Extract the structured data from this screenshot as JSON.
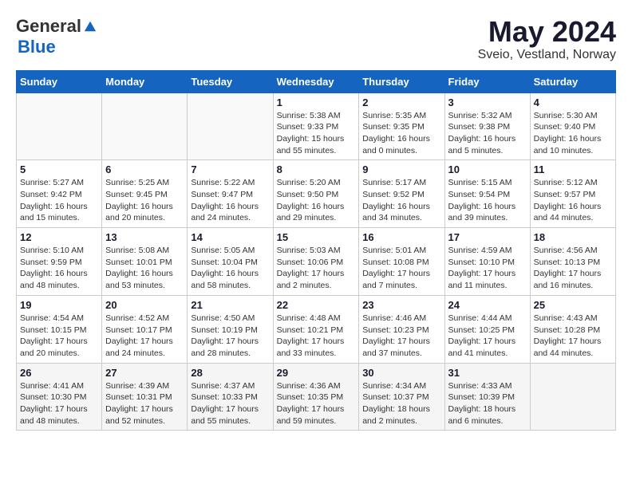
{
  "logo": {
    "general": "General",
    "blue": "Blue"
  },
  "title": {
    "month_year": "May 2024",
    "location": "Sveio, Vestland, Norway"
  },
  "weekdays": [
    "Sunday",
    "Monday",
    "Tuesday",
    "Wednesday",
    "Thursday",
    "Friday",
    "Saturday"
  ],
  "weeks": [
    [
      {
        "day": "",
        "info": ""
      },
      {
        "day": "",
        "info": ""
      },
      {
        "day": "",
        "info": ""
      },
      {
        "day": "1",
        "info": "Sunrise: 5:38 AM\nSunset: 9:33 PM\nDaylight: 15 hours\nand 55 minutes."
      },
      {
        "day": "2",
        "info": "Sunrise: 5:35 AM\nSunset: 9:35 PM\nDaylight: 16 hours\nand 0 minutes."
      },
      {
        "day": "3",
        "info": "Sunrise: 5:32 AM\nSunset: 9:38 PM\nDaylight: 16 hours\nand 5 minutes."
      },
      {
        "day": "4",
        "info": "Sunrise: 5:30 AM\nSunset: 9:40 PM\nDaylight: 16 hours\nand 10 minutes."
      }
    ],
    [
      {
        "day": "5",
        "info": "Sunrise: 5:27 AM\nSunset: 9:42 PM\nDaylight: 16 hours\nand 15 minutes."
      },
      {
        "day": "6",
        "info": "Sunrise: 5:25 AM\nSunset: 9:45 PM\nDaylight: 16 hours\nand 20 minutes."
      },
      {
        "day": "7",
        "info": "Sunrise: 5:22 AM\nSunset: 9:47 PM\nDaylight: 16 hours\nand 24 minutes."
      },
      {
        "day": "8",
        "info": "Sunrise: 5:20 AM\nSunset: 9:50 PM\nDaylight: 16 hours\nand 29 minutes."
      },
      {
        "day": "9",
        "info": "Sunrise: 5:17 AM\nSunset: 9:52 PM\nDaylight: 16 hours\nand 34 minutes."
      },
      {
        "day": "10",
        "info": "Sunrise: 5:15 AM\nSunset: 9:54 PM\nDaylight: 16 hours\nand 39 minutes."
      },
      {
        "day": "11",
        "info": "Sunrise: 5:12 AM\nSunset: 9:57 PM\nDaylight: 16 hours\nand 44 minutes."
      }
    ],
    [
      {
        "day": "12",
        "info": "Sunrise: 5:10 AM\nSunset: 9:59 PM\nDaylight: 16 hours\nand 48 minutes."
      },
      {
        "day": "13",
        "info": "Sunrise: 5:08 AM\nSunset: 10:01 PM\nDaylight: 16 hours\nand 53 minutes."
      },
      {
        "day": "14",
        "info": "Sunrise: 5:05 AM\nSunset: 10:04 PM\nDaylight: 16 hours\nand 58 minutes."
      },
      {
        "day": "15",
        "info": "Sunrise: 5:03 AM\nSunset: 10:06 PM\nDaylight: 17 hours\nand 2 minutes."
      },
      {
        "day": "16",
        "info": "Sunrise: 5:01 AM\nSunset: 10:08 PM\nDaylight: 17 hours\nand 7 minutes."
      },
      {
        "day": "17",
        "info": "Sunrise: 4:59 AM\nSunset: 10:10 PM\nDaylight: 17 hours\nand 11 minutes."
      },
      {
        "day": "18",
        "info": "Sunrise: 4:56 AM\nSunset: 10:13 PM\nDaylight: 17 hours\nand 16 minutes."
      }
    ],
    [
      {
        "day": "19",
        "info": "Sunrise: 4:54 AM\nSunset: 10:15 PM\nDaylight: 17 hours\nand 20 minutes."
      },
      {
        "day": "20",
        "info": "Sunrise: 4:52 AM\nSunset: 10:17 PM\nDaylight: 17 hours\nand 24 minutes."
      },
      {
        "day": "21",
        "info": "Sunrise: 4:50 AM\nSunset: 10:19 PM\nDaylight: 17 hours\nand 28 minutes."
      },
      {
        "day": "22",
        "info": "Sunrise: 4:48 AM\nSunset: 10:21 PM\nDaylight: 17 hours\nand 33 minutes."
      },
      {
        "day": "23",
        "info": "Sunrise: 4:46 AM\nSunset: 10:23 PM\nDaylight: 17 hours\nand 37 minutes."
      },
      {
        "day": "24",
        "info": "Sunrise: 4:44 AM\nSunset: 10:25 PM\nDaylight: 17 hours\nand 41 minutes."
      },
      {
        "day": "25",
        "info": "Sunrise: 4:43 AM\nSunset: 10:28 PM\nDaylight: 17 hours\nand 44 minutes."
      }
    ],
    [
      {
        "day": "26",
        "info": "Sunrise: 4:41 AM\nSunset: 10:30 PM\nDaylight: 17 hours\nand 48 minutes."
      },
      {
        "day": "27",
        "info": "Sunrise: 4:39 AM\nSunset: 10:31 PM\nDaylight: 17 hours\nand 52 minutes."
      },
      {
        "day": "28",
        "info": "Sunrise: 4:37 AM\nSunset: 10:33 PM\nDaylight: 17 hours\nand 55 minutes."
      },
      {
        "day": "29",
        "info": "Sunrise: 4:36 AM\nSunset: 10:35 PM\nDaylight: 17 hours\nand 59 minutes."
      },
      {
        "day": "30",
        "info": "Sunrise: 4:34 AM\nSunset: 10:37 PM\nDaylight: 18 hours\nand 2 minutes."
      },
      {
        "day": "31",
        "info": "Sunrise: 4:33 AM\nSunset: 10:39 PM\nDaylight: 18 hours\nand 6 minutes."
      },
      {
        "day": "",
        "info": ""
      }
    ]
  ]
}
